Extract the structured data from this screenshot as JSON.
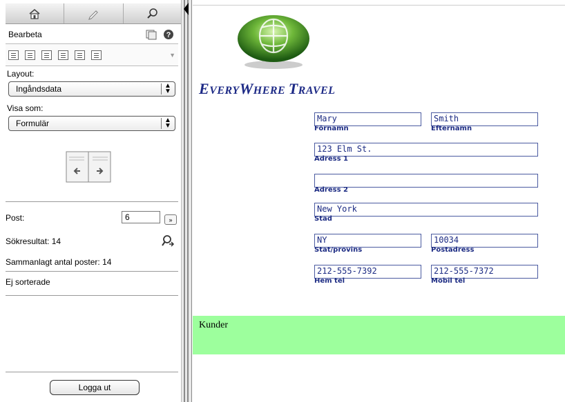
{
  "sidebar": {
    "mode_buttons": [
      {
        "name": "home-icon"
      },
      {
        "name": "pencil-icon"
      },
      {
        "name": "search-icon"
      }
    ],
    "title": "Bearbeta",
    "layout_label": "Layout:",
    "layout_value": "Ingåndsdata",
    "view_as_label": "Visa som:",
    "view_as_value": "Formulär",
    "post_label": "Post:",
    "post_value": "6",
    "post_go": "»",
    "search_results": "Sökresultat: 14",
    "total_records": "Sammanlagt antal poster: 14",
    "sort_status": "Ej sorterade",
    "logout": "Logga ut"
  },
  "content": {
    "company_name": {
      "big1": "E",
      "small1": "VERY",
      "big2": "W",
      "small2": "HERE ",
      "big3": "T",
      "small3": "RAVEL"
    },
    "fields": {
      "first_name": {
        "value": "Mary",
        "label": "Förnamn"
      },
      "last_name": {
        "value": "Smith",
        "label": "Efternamn"
      },
      "address1": {
        "value": "123 Elm St.",
        "label": "Adress 1"
      },
      "address2": {
        "value": "",
        "label": "Adress 2"
      },
      "city": {
        "value": "New York",
        "label": "Stad"
      },
      "state": {
        "value": "NY",
        "label": "Stat/provins"
      },
      "postal": {
        "value": "10034",
        "label": "Postadress"
      },
      "home_phone": {
        "value": "212-555-7392",
        "label": "Hem tel"
      },
      "mobile_phone": {
        "value": "212-555-7372",
        "label": "Mobil tel"
      }
    },
    "footer": "Kunder"
  },
  "colors": {
    "brand": "#1d2a86",
    "field_text": "#1c2b83",
    "footer_band": "#9dff9d"
  }
}
